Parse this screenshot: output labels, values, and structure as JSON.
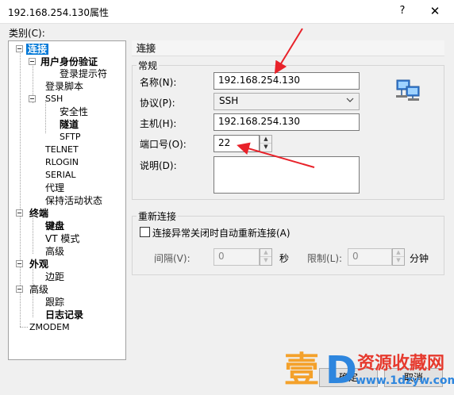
{
  "window": {
    "title": "192.168.254.130属性",
    "help_glyph": "?",
    "close_glyph": "✕"
  },
  "category_label": "类别(C):",
  "tree": [
    {
      "label": "连接",
      "bold": true,
      "selected": true
    },
    {
      "label": "用户身份验证",
      "bold": true
    },
    {
      "label": "登录提示符"
    },
    {
      "label": "登录脚本"
    },
    {
      "label": "SSH",
      "small": true
    },
    {
      "label": "安全性"
    },
    {
      "label": "隧道",
      "bold": true
    },
    {
      "label": "SFTP",
      "small": true
    },
    {
      "label": "TELNET",
      "small": true
    },
    {
      "label": "RLOGIN",
      "small": true
    },
    {
      "label": "SERIAL",
      "small": true
    },
    {
      "label": "代理"
    },
    {
      "label": "保持活动状态"
    },
    {
      "label": "终端",
      "bold": true
    },
    {
      "label": "键盘",
      "bold": true
    },
    {
      "label": "VT 模式"
    },
    {
      "label": "高级"
    },
    {
      "label": "外观",
      "bold": true
    },
    {
      "label": "边距"
    },
    {
      "label": "高级"
    },
    {
      "label": "跟踪"
    },
    {
      "label": "日志记录",
      "bold": true
    },
    {
      "label": "ZMODEM",
      "small": true
    }
  ],
  "section_header": "连接",
  "general": {
    "title": "常规",
    "name_label": "名称(N):",
    "name_value": "192.168.254.130",
    "protocol_label": "协议(P):",
    "protocol_value": "SSH",
    "host_label": "主机(H):",
    "host_value": "192.168.254.130",
    "port_label": "端口号(O):",
    "port_value": "22",
    "desc_label": "说明(D):",
    "desc_value": ""
  },
  "reconnect": {
    "title": "重新连接",
    "checkbox_label": "连接异常关闭时自动重新连接(A)",
    "checked": false,
    "interval_label": "间隔(V):",
    "interval_value": "0",
    "interval_unit": "秒",
    "limit_label": "限制(L):",
    "limit_value": "0",
    "limit_unit": "分钟"
  },
  "buttons": {
    "ok_partial": "确定",
    "cancel": "取消"
  },
  "watermark": {
    "big_char": "壹",
    "d_char": "D",
    "cn_text": "资源收藏网",
    "url_text": "www.1dzyw.com"
  },
  "colors": {
    "selection": "#0078d7",
    "annotation_arrow": "#e8222a",
    "watermark_orange": "#f4a12b",
    "watermark_blue": "#2e86de",
    "watermark_red": "#e63a2e"
  }
}
